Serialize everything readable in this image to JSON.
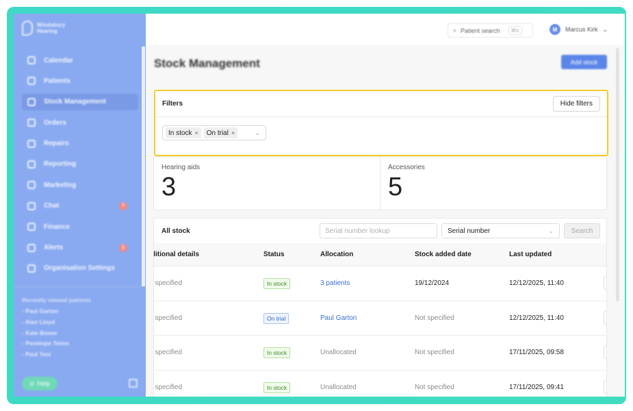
{
  "sidebar": {
    "brand": [
      "Windsbury",
      "Hearing"
    ],
    "items": [
      {
        "label": "Calendar",
        "icon": "calendar-icon",
        "active": false,
        "badge": ""
      },
      {
        "label": "Patients",
        "icon": "patients-icon",
        "active": false,
        "badge": ""
      },
      {
        "label": "Stock Management",
        "icon": "box-icon",
        "active": true,
        "badge": ""
      },
      {
        "label": "Orders",
        "icon": "orders-icon",
        "active": false,
        "badge": ""
      },
      {
        "label": "Repairs",
        "icon": "wrench-icon",
        "active": false,
        "badge": ""
      },
      {
        "label": "Reporting",
        "icon": "chart-icon",
        "active": false,
        "badge": ""
      },
      {
        "label": "Marketing",
        "icon": "mail-icon",
        "active": false,
        "badge": ""
      },
      {
        "label": "Chat",
        "icon": "chat-icon",
        "active": false,
        "badge": "7"
      },
      {
        "label": "Finance",
        "icon": "card-icon",
        "active": false,
        "badge": ""
      },
      {
        "label": "Alerts",
        "icon": "bell-icon",
        "active": false,
        "badge": "1"
      },
      {
        "label": "Organisation Settings",
        "icon": "gear-icon",
        "active": false,
        "badge": ""
      }
    ],
    "recent_title": "Recently viewed patients",
    "recent": [
      "- Paul Garton",
      "- Alan Lloyd",
      "- Kate Bower",
      "- Penelope Twine",
      "- Paul Test"
    ],
    "help_label": "Help"
  },
  "topbar": {
    "search_label": "Patient search",
    "search_shortcut": "⌘K",
    "user_initial": "M",
    "user_name": "Marcus Kirk"
  },
  "page": {
    "title": "Stock Management",
    "add_label": "Add stock"
  },
  "filters": {
    "title": "Filters",
    "hide_label": "Hide filters",
    "tags": [
      "In stock",
      "On trial"
    ]
  },
  "stats": [
    {
      "label": "Hearing aids",
      "value": "3"
    },
    {
      "label": "Accessories",
      "value": "5"
    }
  ],
  "stock": {
    "title": "All stock",
    "lookup_placeholder": "Serial number lookup",
    "lookup_type": "Serial number",
    "search_label": "Search",
    "columns": [
      "ditional details",
      "Status",
      "Allocation",
      "Stock added date",
      "Last updated"
    ],
    "rows": [
      {
        "details": "t specified",
        "status": "In stock",
        "status_type": "instock",
        "allocation": "3 patients",
        "allocation_link": true,
        "added": "19/12/2024",
        "added_muted": false,
        "updated": "12/12/2025, 11:40"
      },
      {
        "details": "t specified",
        "status": "On trial",
        "status_type": "ontrial",
        "allocation": "Paul Garton",
        "allocation_link": true,
        "added": "Not specified",
        "added_muted": true,
        "updated": "12/12/2025, 11:40"
      },
      {
        "details": "t specified",
        "status": "In stock",
        "status_type": "instock",
        "allocation": "Unallocated",
        "allocation_link": false,
        "added": "Not specified",
        "added_muted": true,
        "updated": "17/11/2025, 09:58"
      },
      {
        "details": "t specified",
        "status": "In stock",
        "status_type": "instock",
        "allocation": "Unallocated",
        "allocation_link": false,
        "added": "Not specified",
        "added_muted": true,
        "updated": "17/11/2025, 09:41"
      }
    ]
  }
}
